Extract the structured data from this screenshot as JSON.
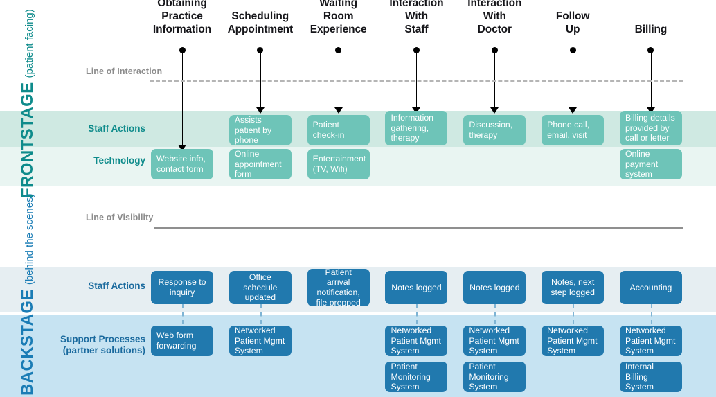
{
  "columns": [
    {
      "id": "obtaining-practice-information",
      "label": "Obtaining\nPractice\nInformation"
    },
    {
      "id": "scheduling-appointment",
      "label": "Scheduling\nAppointment"
    },
    {
      "id": "waiting-room-experience",
      "label": "Waiting\nRoom\nExperience"
    },
    {
      "id": "interaction-with-staff",
      "label": "Interaction\nWith\nStaff"
    },
    {
      "id": "interaction-with-doctor",
      "label": "Interaction\nWith\nDoctor"
    },
    {
      "id": "follow-up",
      "label": "Follow\nUp"
    },
    {
      "id": "billing",
      "label": "Billing"
    }
  ],
  "lines": {
    "interaction": "Line of Interaction",
    "visibility": "Line of Visibility"
  },
  "stages": {
    "frontstage": {
      "title": "FRONTSTAGE",
      "subtitle": "(patient facing)",
      "color": "#0e8b8b"
    },
    "backstage": {
      "title": "BACKSTAGE",
      "subtitle": "(behind the scenes)",
      "color": "#1a7cb5"
    }
  },
  "rows": {
    "frontstage_staff_actions": "Staff Actions",
    "frontstage_technology": "Technology",
    "backstage_staff_actions": "Staff Actions",
    "backstage_support_processes": "Support Processes\n(partner solutions)"
  },
  "colors": {
    "teal_box": "#6ec4b8",
    "blue_box": "#2179ae",
    "frontstage_band_1": "#cfe9e2",
    "frontstage_band_2": "#e9f5f2",
    "backstage_band_1": "#e6eef2",
    "backstage_band_2": "#c6e3f2",
    "line_gray": "#8f8f8f"
  },
  "cells": {
    "frontstage_staff_actions": [
      null,
      "Assists patient by phone",
      "Patient check-in",
      "Information gathering, therapy",
      "Discussion, therapy",
      "Phone call, email, visit",
      "Billing details provided by call or letter"
    ],
    "frontstage_technology": [
      "Website info, contact form",
      "Online appointment form",
      "Entertainment (TV, Wifi)",
      null,
      null,
      null,
      "Online payment system"
    ],
    "backstage_staff_actions": [
      "Response to inquiry",
      "Office schedule updated",
      "Patient arrival notification, file prepped",
      "Notes logged",
      "Notes logged",
      "Notes, next step logged",
      "Accounting"
    ],
    "backstage_support_primary": [
      "Web form forwarding",
      "Networked Patient Mgmt System",
      null,
      "Networked Patient Mgmt System",
      "Networked Patient Mgmt System",
      "Networked Patient Mgmt System",
      "Networked Patient Mgmt System"
    ],
    "backstage_support_secondary": [
      null,
      null,
      null,
      "Patient Monitoring System",
      "Patient Monitoring System",
      null,
      "Internal Billing System"
    ]
  }
}
